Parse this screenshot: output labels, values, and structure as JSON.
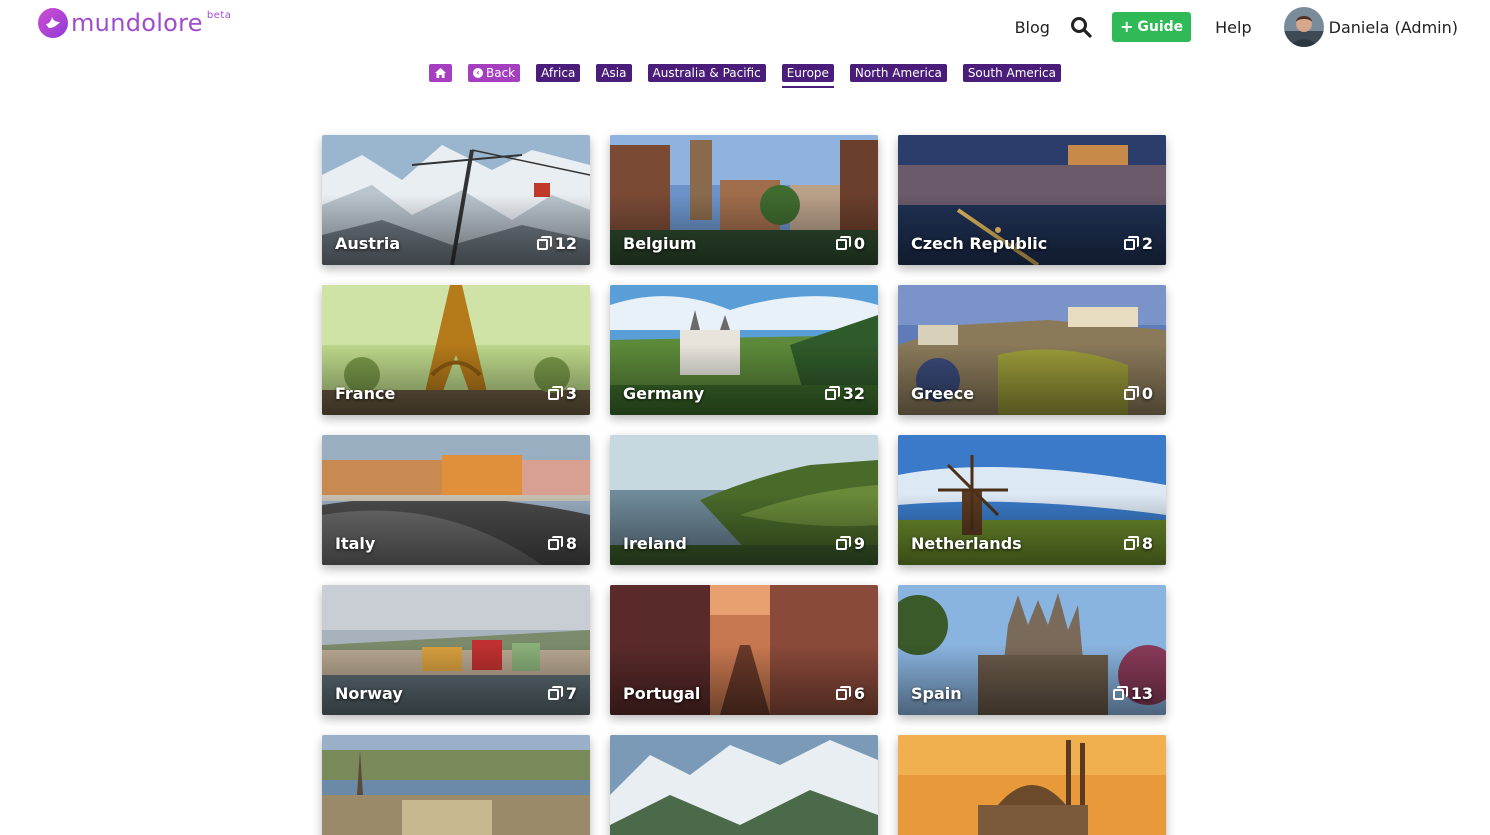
{
  "brand": {
    "name": "mundolore",
    "tag": "beta",
    "colors": {
      "primary": "#a04ccf",
      "dark": "#4b1d7a",
      "accent": "#2fba57"
    }
  },
  "nav": {
    "blog": "Blog",
    "search_icon": "search-icon",
    "guide": {
      "icon": "+",
      "label": "Guide"
    },
    "help": "Help",
    "user": "Daniela (Admin)"
  },
  "continents": {
    "home_icon": "home-icon",
    "back": "Back",
    "items": [
      "Africa",
      "Asia",
      "Australia & Pacific",
      "Europe",
      "North America",
      "South America"
    ],
    "active": "Europe"
  },
  "countries": [
    {
      "name": "Austria",
      "count": "12"
    },
    {
      "name": "Belgium",
      "count": "0"
    },
    {
      "name": "Czech Republic",
      "count": "2"
    },
    {
      "name": "France",
      "count": "3"
    },
    {
      "name": "Germany",
      "count": "32"
    },
    {
      "name": "Greece",
      "count": "0"
    },
    {
      "name": "Italy",
      "count": "8"
    },
    {
      "name": "Ireland",
      "count": "9"
    },
    {
      "name": "Netherlands",
      "count": "8"
    },
    {
      "name": "Norway",
      "count": "7"
    },
    {
      "name": "Portugal",
      "count": "6"
    },
    {
      "name": "Spain",
      "count": "13"
    },
    {
      "name": "",
      "count": ""
    },
    {
      "name": "",
      "count": ""
    },
    {
      "name": "",
      "count": ""
    }
  ]
}
